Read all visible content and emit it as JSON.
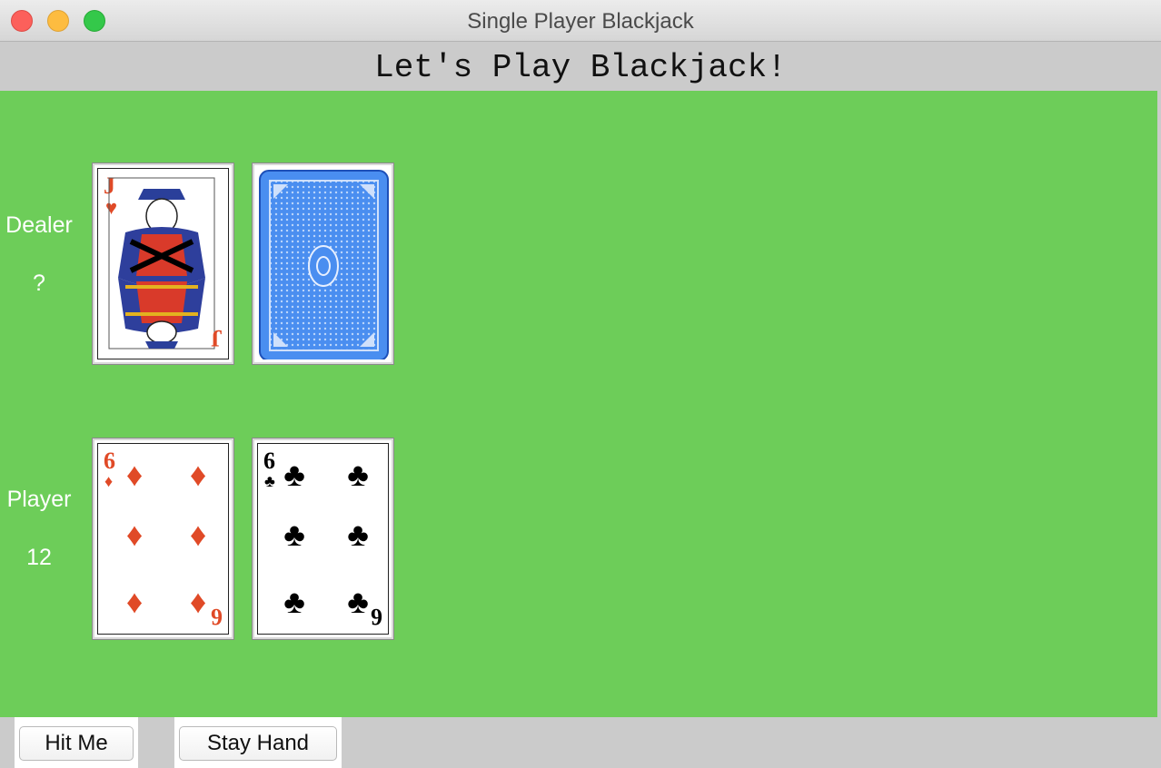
{
  "window": {
    "title": "Single Player Blackjack"
  },
  "heading": "Let's Play Blackjack!",
  "dealer": {
    "label": "Dealer",
    "score": "?"
  },
  "player": {
    "label": "Player",
    "score": "12"
  },
  "cards": {
    "dealer_up": {
      "rank": "J",
      "suit": "♥"
    },
    "dealer_hidden": {
      "face": "card back"
    },
    "player_1": {
      "rank": "6",
      "suit": "♦"
    },
    "player_2": {
      "rank": "6",
      "suit": "♣"
    }
  },
  "buttons": {
    "hit": "Hit Me",
    "stay": "Stay Hand"
  },
  "colors": {
    "table": "#6dcd59",
    "card_back": "#4a8ef0",
    "red_suit": "#e04a27"
  }
}
